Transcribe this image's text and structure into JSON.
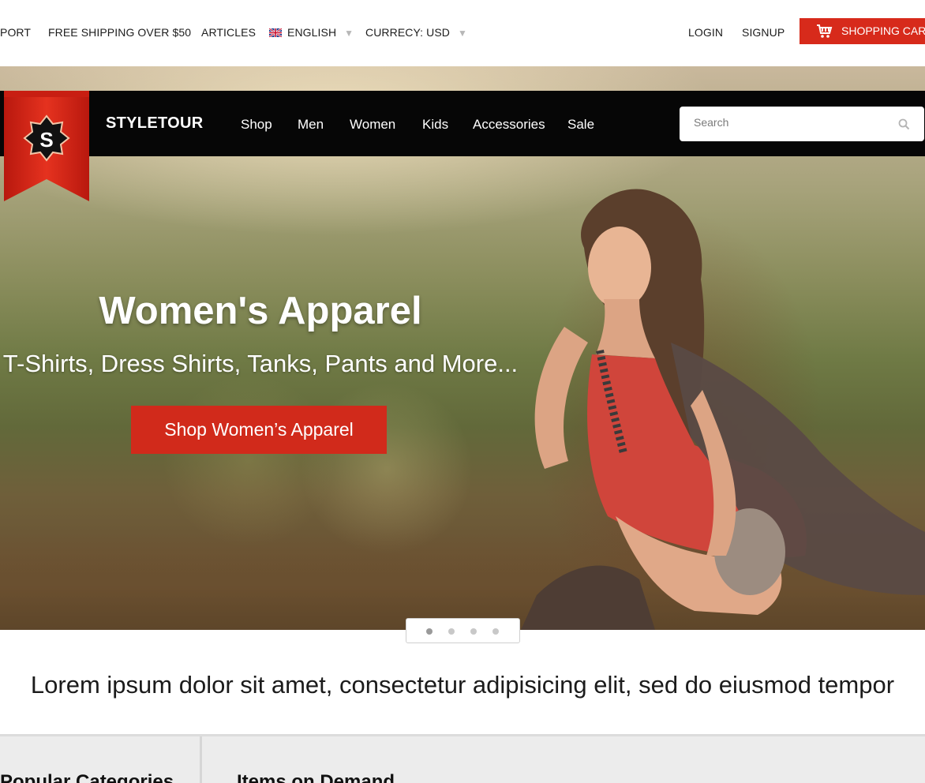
{
  "topbar": {
    "support_label": "PORT",
    "shipping_label": "FREE SHIPPING OVER $50",
    "articles_label": "ARTICLES",
    "language_label": "ENGLISH",
    "currency_label": "CURRECY: USD",
    "login_label": "LOGIN",
    "signup_label": "SIGNUP",
    "cart_label": "SHOPPING CART"
  },
  "brand": {
    "badge_letter": "S",
    "name": "STYLETOUR"
  },
  "nav": {
    "items": [
      "Shop",
      "Men",
      "Women",
      "Kids",
      "Accessories",
      "Sale"
    ]
  },
  "search": {
    "placeholder": "Search"
  },
  "hero": {
    "title": "Women's Apparel",
    "subtitle": "T-Shirts, Dress Shirts, Tanks, Pants and More...",
    "cta_label": "Shop Women’s Apparel"
  },
  "slider": {
    "count": 4,
    "active_index": 0
  },
  "tagline": "Lorem ipsum dolor sit amet, consectetur adipisicing elit, sed do eiusmod tempor",
  "bottom": {
    "left_title": "Popular Categories",
    "right_title": "Items on Demand"
  },
  "colors": {
    "accent": "#d72a1b",
    "navbar": "#060606"
  },
  "icons": {
    "cart": "shopping-cart-icon",
    "search": "search-icon",
    "flag": "uk-flag-icon",
    "caret": "caret-down-icon"
  }
}
